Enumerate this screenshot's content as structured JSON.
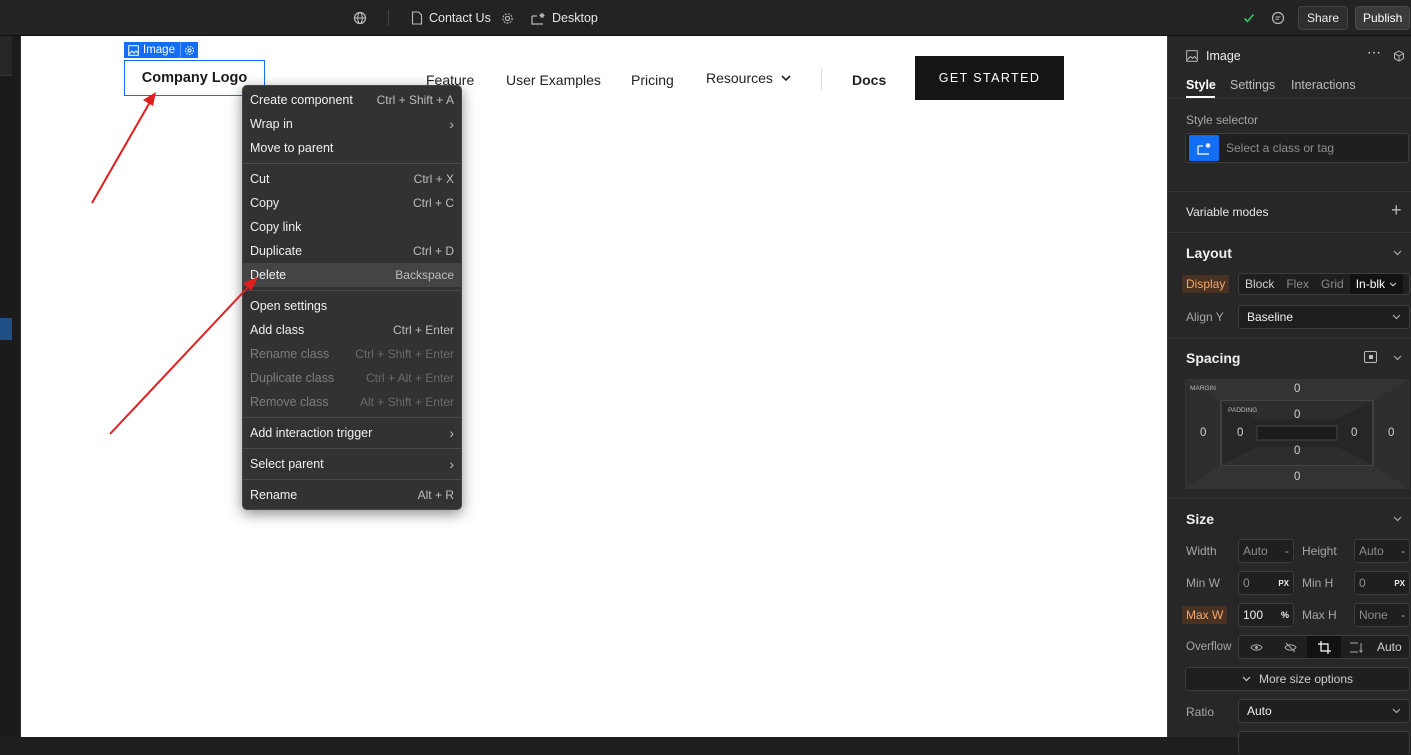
{
  "topbar": {
    "page_name": "Contact Us",
    "breakpoint": "Desktop",
    "share_label": "Share",
    "publish_label": "Publish"
  },
  "canvas": {
    "selection_label": "Image",
    "logo_text": "Company Logo",
    "nav": [
      "Feature",
      "User Examples",
      "Pricing",
      "Resources"
    ],
    "docs_label": "Docs",
    "cta_label": "GET STARTED"
  },
  "context_menu": {
    "items": [
      {
        "label": "Create component",
        "shortcut": "Ctrl + Shift + A"
      },
      {
        "label": "Wrap in",
        "shortcut": "›"
      },
      {
        "label": "Move to parent",
        "shortcut": ""
      },
      {
        "label": "Cut",
        "shortcut": "Ctrl + X"
      },
      {
        "label": "Copy",
        "shortcut": "Ctrl + C"
      },
      {
        "label": "Copy link",
        "shortcut": ""
      },
      {
        "label": "Duplicate",
        "shortcut": "Ctrl + D"
      },
      {
        "label": "Delete",
        "shortcut": "Backspace"
      },
      {
        "label": "Open settings",
        "shortcut": ""
      },
      {
        "label": "Add class",
        "shortcut": "Ctrl + Enter"
      },
      {
        "label": "Rename class",
        "shortcut": "Ctrl + Shift + Enter"
      },
      {
        "label": "Duplicate class",
        "shortcut": "Ctrl + Alt + Enter"
      },
      {
        "label": "Remove class",
        "shortcut": "Alt + Shift + Enter"
      },
      {
        "label": "Add interaction trigger",
        "shortcut": "›"
      },
      {
        "label": "Select parent",
        "shortcut": "›"
      },
      {
        "label": "Rename",
        "shortcut": "Alt + R"
      }
    ]
  },
  "panel": {
    "element_name": "Image",
    "tabs": [
      "Style",
      "Settings",
      "Interactions"
    ],
    "style_selector_label": "Style selector",
    "style_selector_placeholder": "Select a class or tag",
    "variable_modes_label": "Variable modes",
    "layout": {
      "title": "Layout",
      "display_label": "Display",
      "display_options": [
        "Block",
        "Flex",
        "Grid",
        "In-blk"
      ],
      "align_y_label": "Align Y",
      "align_y_value": "Baseline"
    },
    "spacing": {
      "title": "Spacing",
      "margin_label": "MARGIN",
      "padding_label": "PADDING",
      "margin": {
        "top": "0",
        "right": "0",
        "bottom": "0",
        "left": "0"
      },
      "padding": {
        "top": "0",
        "right": "0",
        "bottom": "0",
        "left": "0"
      }
    },
    "size": {
      "title": "Size",
      "width_label": "Width",
      "width_value": "Auto",
      "height_label": "Height",
      "height_value": "Auto",
      "min_w_label": "Min W",
      "min_w_value": "0",
      "min_w_unit": "PX",
      "min_h_label": "Min H",
      "min_h_value": "0",
      "min_h_unit": "PX",
      "max_w_label": "Max W",
      "max_w_value": "100",
      "max_w_unit": "%",
      "max_h_label": "Max H",
      "max_h_value": "None",
      "overflow_label": "Overflow",
      "overflow_auto": "Auto",
      "more_options": "More size options",
      "ratio_label": "Ratio",
      "ratio_value": "Auto",
      "dash": "-"
    }
  }
}
